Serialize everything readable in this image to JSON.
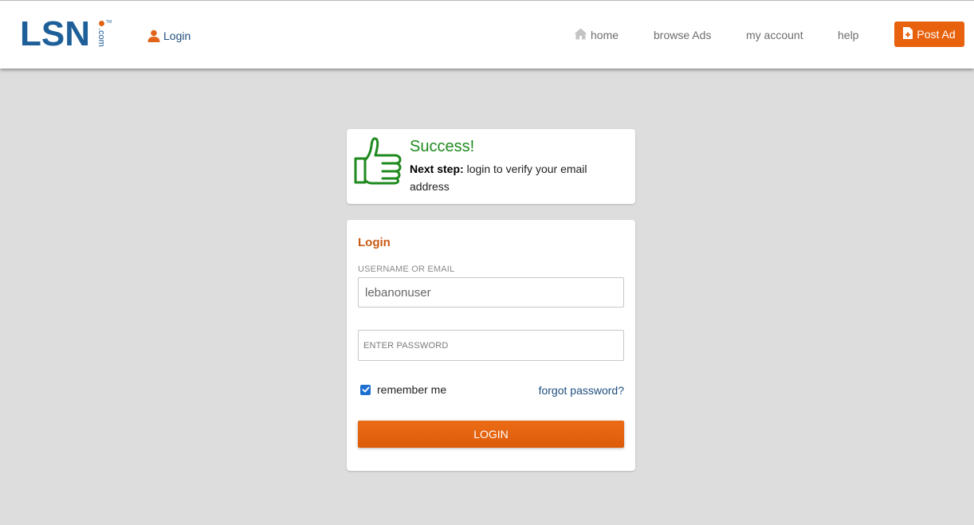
{
  "header": {
    "logo_text": "LSN",
    "logo_com": ".com",
    "logo_tm": "TM",
    "login_label": "Login",
    "nav": {
      "home": "home",
      "browse": "browse Ads",
      "account": "my account",
      "help": "help"
    },
    "post_ad_label": "Post Ad"
  },
  "success": {
    "title": "Success!",
    "next_step_label": "Next step:",
    "message": " login to verify your email address"
  },
  "login_form": {
    "heading": "Login",
    "username_label": "USERNAME OR EMAIL",
    "username_value": "lebanonuser",
    "password_placeholder": "ENTER PASSWORD",
    "remember_label": "remember me",
    "remember_checked": true,
    "forgot_label": "forgot password?",
    "submit_label": "LOGIN"
  },
  "colors": {
    "brand_blue": "#1f5f99",
    "accent_orange": "#e8620e",
    "success_green": "#1f8a1f",
    "page_background": "#dddddd"
  },
  "icons": {
    "login": "user-icon",
    "home": "home-icon",
    "post_ad": "file-plus-icon",
    "success": "thumbs-up-icon",
    "checkbox": "checkmark-icon"
  }
}
